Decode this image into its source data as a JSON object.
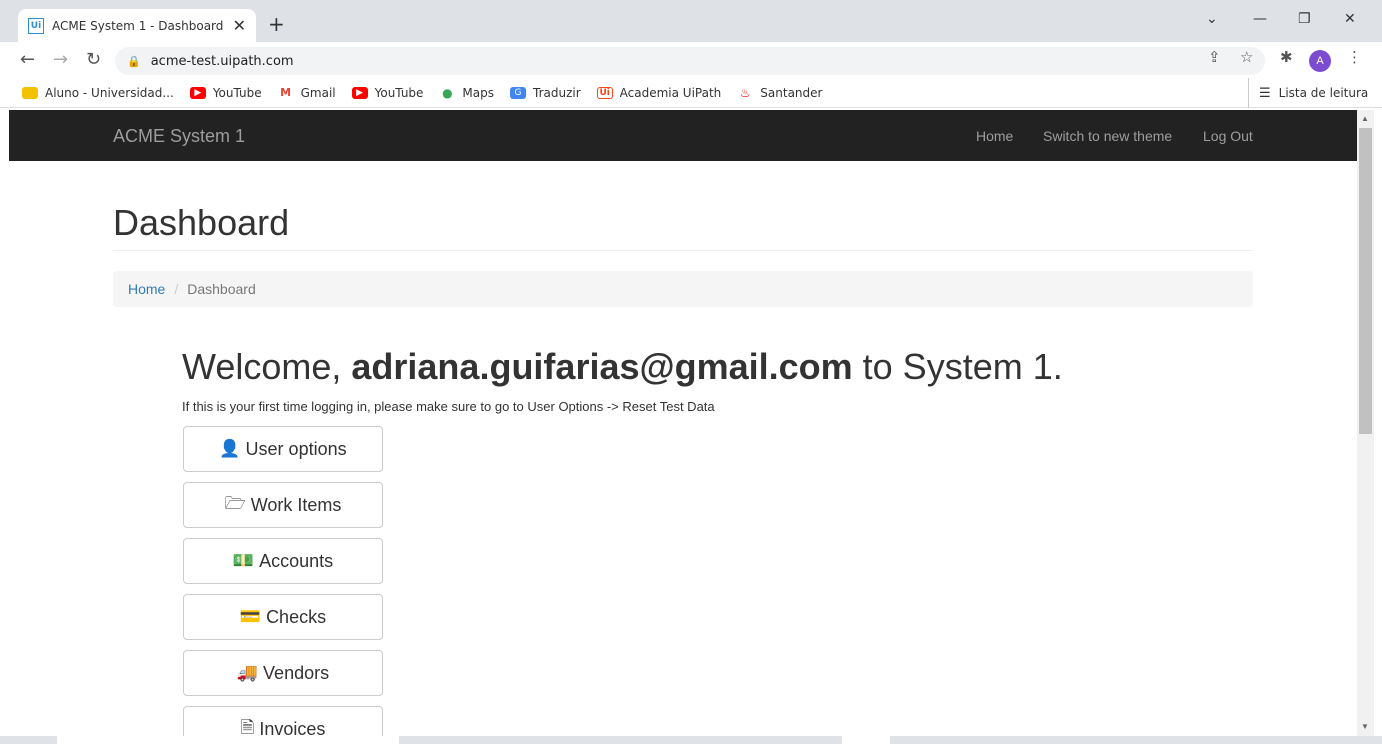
{
  "browser": {
    "tab_title": "ACME System 1 - Dashboard",
    "tab_favicon_text": "Ui",
    "tab_close": "✕",
    "new_tab": "+",
    "url": "acme-test.uipath.com",
    "profile_initial": "A",
    "bookmarks": [
      {
        "label": "Aluno - Universidad...",
        "icon": "university-icon",
        "color": "#f2c200"
      },
      {
        "label": "YouTube",
        "icon": "youtube-icon",
        "color": "#ff0000"
      },
      {
        "label": "Gmail",
        "icon": "gmail-icon",
        "color": "#ea4335"
      },
      {
        "label": "YouTube",
        "icon": "youtube-icon",
        "color": "#ff0000"
      },
      {
        "label": "Maps",
        "icon": "maps-icon",
        "color": "#34a853"
      },
      {
        "label": "Traduzir",
        "icon": "translate-icon",
        "color": "#4285f4"
      },
      {
        "label": "Academia UiPath",
        "icon": "uipath-icon",
        "color": "#fa4616"
      },
      {
        "label": "Santander",
        "icon": "santander-icon",
        "color": "#ec0000"
      }
    ],
    "reading_list": "Lista de leitura"
  },
  "app": {
    "brand": "ACME System 1",
    "nav": {
      "home": "Home",
      "switch_theme": "Switch to new theme",
      "logout": "Log Out"
    },
    "page_title": "Dashboard",
    "breadcrumb": {
      "home": "Home",
      "separator": "/",
      "current": "Dashboard"
    },
    "welcome": {
      "prefix": "Welcome, ",
      "user": "adriana.guifarias@gmail.com",
      "suffix": " to System 1."
    },
    "hint": "If this is your first time logging in, please make sure to go to User Options -> Reset Test Data",
    "menu": [
      {
        "label": "User options",
        "icon": "user-icon"
      },
      {
        "label": "Work Items",
        "icon": "folder-open-icon"
      },
      {
        "label": "Accounts",
        "icon": "money-icon"
      },
      {
        "label": "Checks",
        "icon": "credit-card-icon"
      },
      {
        "label": "Vendors",
        "icon": "truck-icon"
      },
      {
        "label": "Invoices",
        "icon": "file-text-icon"
      }
    ]
  },
  "colors": {
    "navbar_bg": "#222222",
    "nav_text": "#9d9d9d",
    "link": "#337ab7",
    "breadcrumb_bg": "#f5f5f5"
  }
}
